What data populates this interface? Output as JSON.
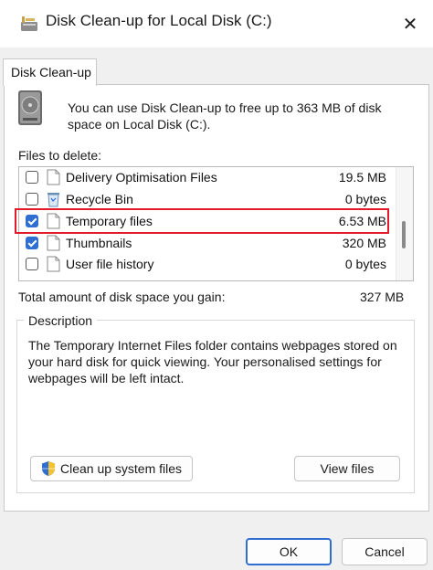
{
  "window": {
    "title": "Disk Clean-up for Local Disk  (C:)",
    "close_glyph": "✕"
  },
  "tab": {
    "label": "Disk Clean-up"
  },
  "intro": {
    "text": "You can use Disk Clean-up to free up to 363 MB of disk space on Local Disk  (C:)."
  },
  "files": {
    "label": "Files to delete:",
    "items": [
      {
        "name": "Delivery Optimisation Files",
        "size": "19.5 MB",
        "checked": false,
        "icon": "file-icon"
      },
      {
        "name": "Recycle Bin",
        "size": "0 bytes",
        "checked": false,
        "icon": "recycle-bin-icon"
      },
      {
        "name": "Temporary files",
        "size": "6.53 MB",
        "checked": true,
        "icon": "file-icon",
        "highlighted": true
      },
      {
        "name": "Thumbnails",
        "size": "320 MB",
        "checked": true,
        "icon": "file-icon"
      },
      {
        "name": "User file history",
        "size": "0 bytes",
        "checked": false,
        "icon": "file-icon"
      }
    ]
  },
  "total": {
    "label": "Total amount of disk space you gain:",
    "value": "327 MB"
  },
  "description": {
    "title": "Description",
    "text": "The Temporary Internet Files folder contains webpages stored on your hard disk for quick viewing. Your personalised settings for webpages will be left intact."
  },
  "buttons": {
    "clean_system": "Clean up system files",
    "view_files": "View files",
    "ok": "OK",
    "cancel": "Cancel"
  },
  "colors": {
    "accent": "#2f6fd1",
    "highlight": "#e21b2b"
  }
}
